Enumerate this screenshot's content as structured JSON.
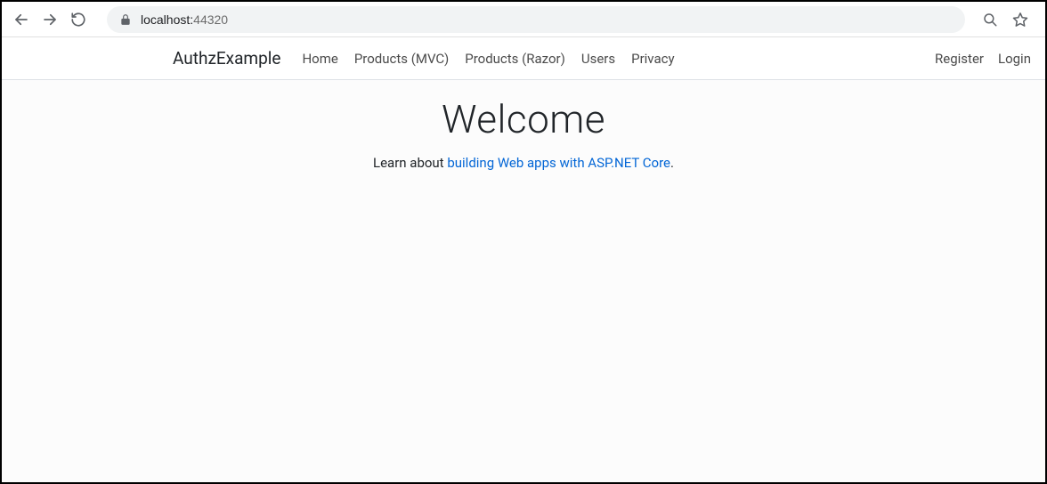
{
  "browser": {
    "url_host": "localhost:",
    "url_port": "44320"
  },
  "navbar": {
    "brand": "AuthzExample",
    "links": [
      "Home",
      "Products (MVC)",
      "Products (Razor)",
      "Users",
      "Privacy"
    ],
    "right": [
      "Register",
      "Login"
    ]
  },
  "hero": {
    "title": "Welcome",
    "lead_prefix": "Learn about ",
    "lead_link": "building Web apps with ASP.NET Core",
    "lead_suffix": "."
  }
}
